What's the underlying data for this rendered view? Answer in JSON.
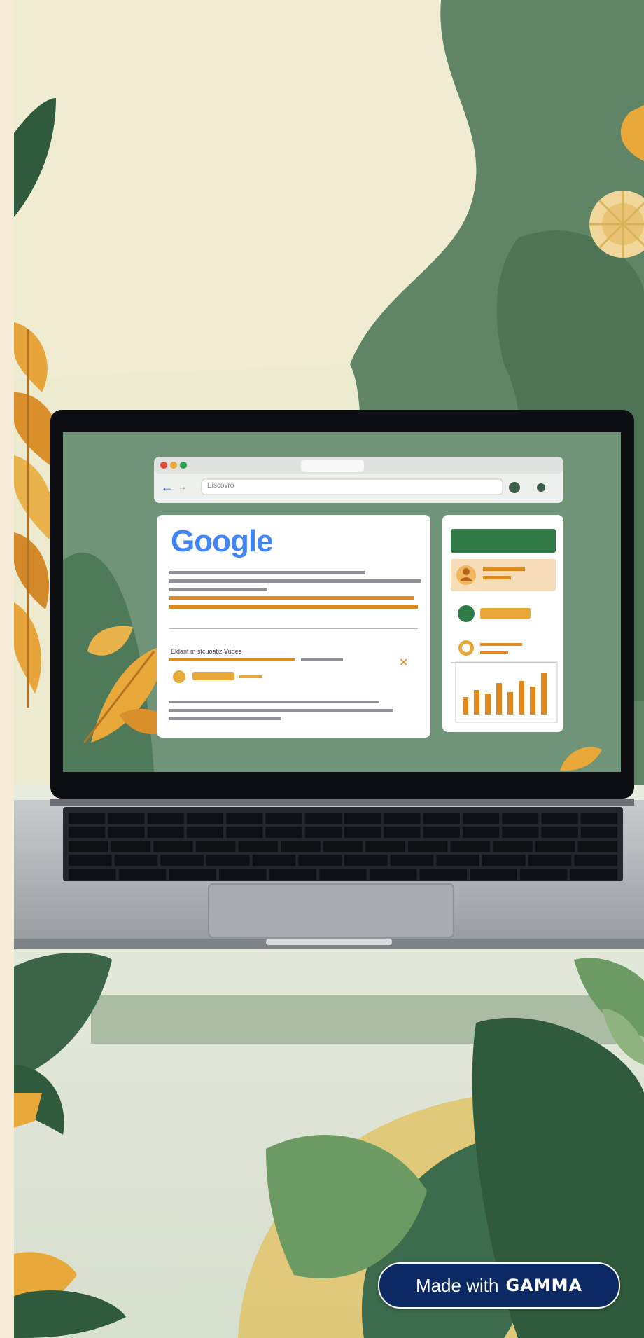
{
  "browser": {
    "address_text": "Eiscovro",
    "logo_text": "Google"
  },
  "results": {
    "heading": "Eldant m stcuoatiz Vudes"
  },
  "colors": {
    "sage_wall": "#6f9478",
    "cream_wall": "#ecebd0",
    "leaf_green": "#3d6b4d",
    "leaf_orange": "#e9a83a",
    "dashboard_green": "#2f7a47",
    "bar_orange": "#e08a1e",
    "badge_navy": "#0b2a63"
  },
  "icons": {
    "back": "back-arrow-icon",
    "forward": "forward-arrow-icon",
    "shield": "shield-icon",
    "profile": "profile-icon",
    "close": "close-x-icon"
  },
  "badge": {
    "made_with": "Made with",
    "brand": "GAMMA"
  }
}
